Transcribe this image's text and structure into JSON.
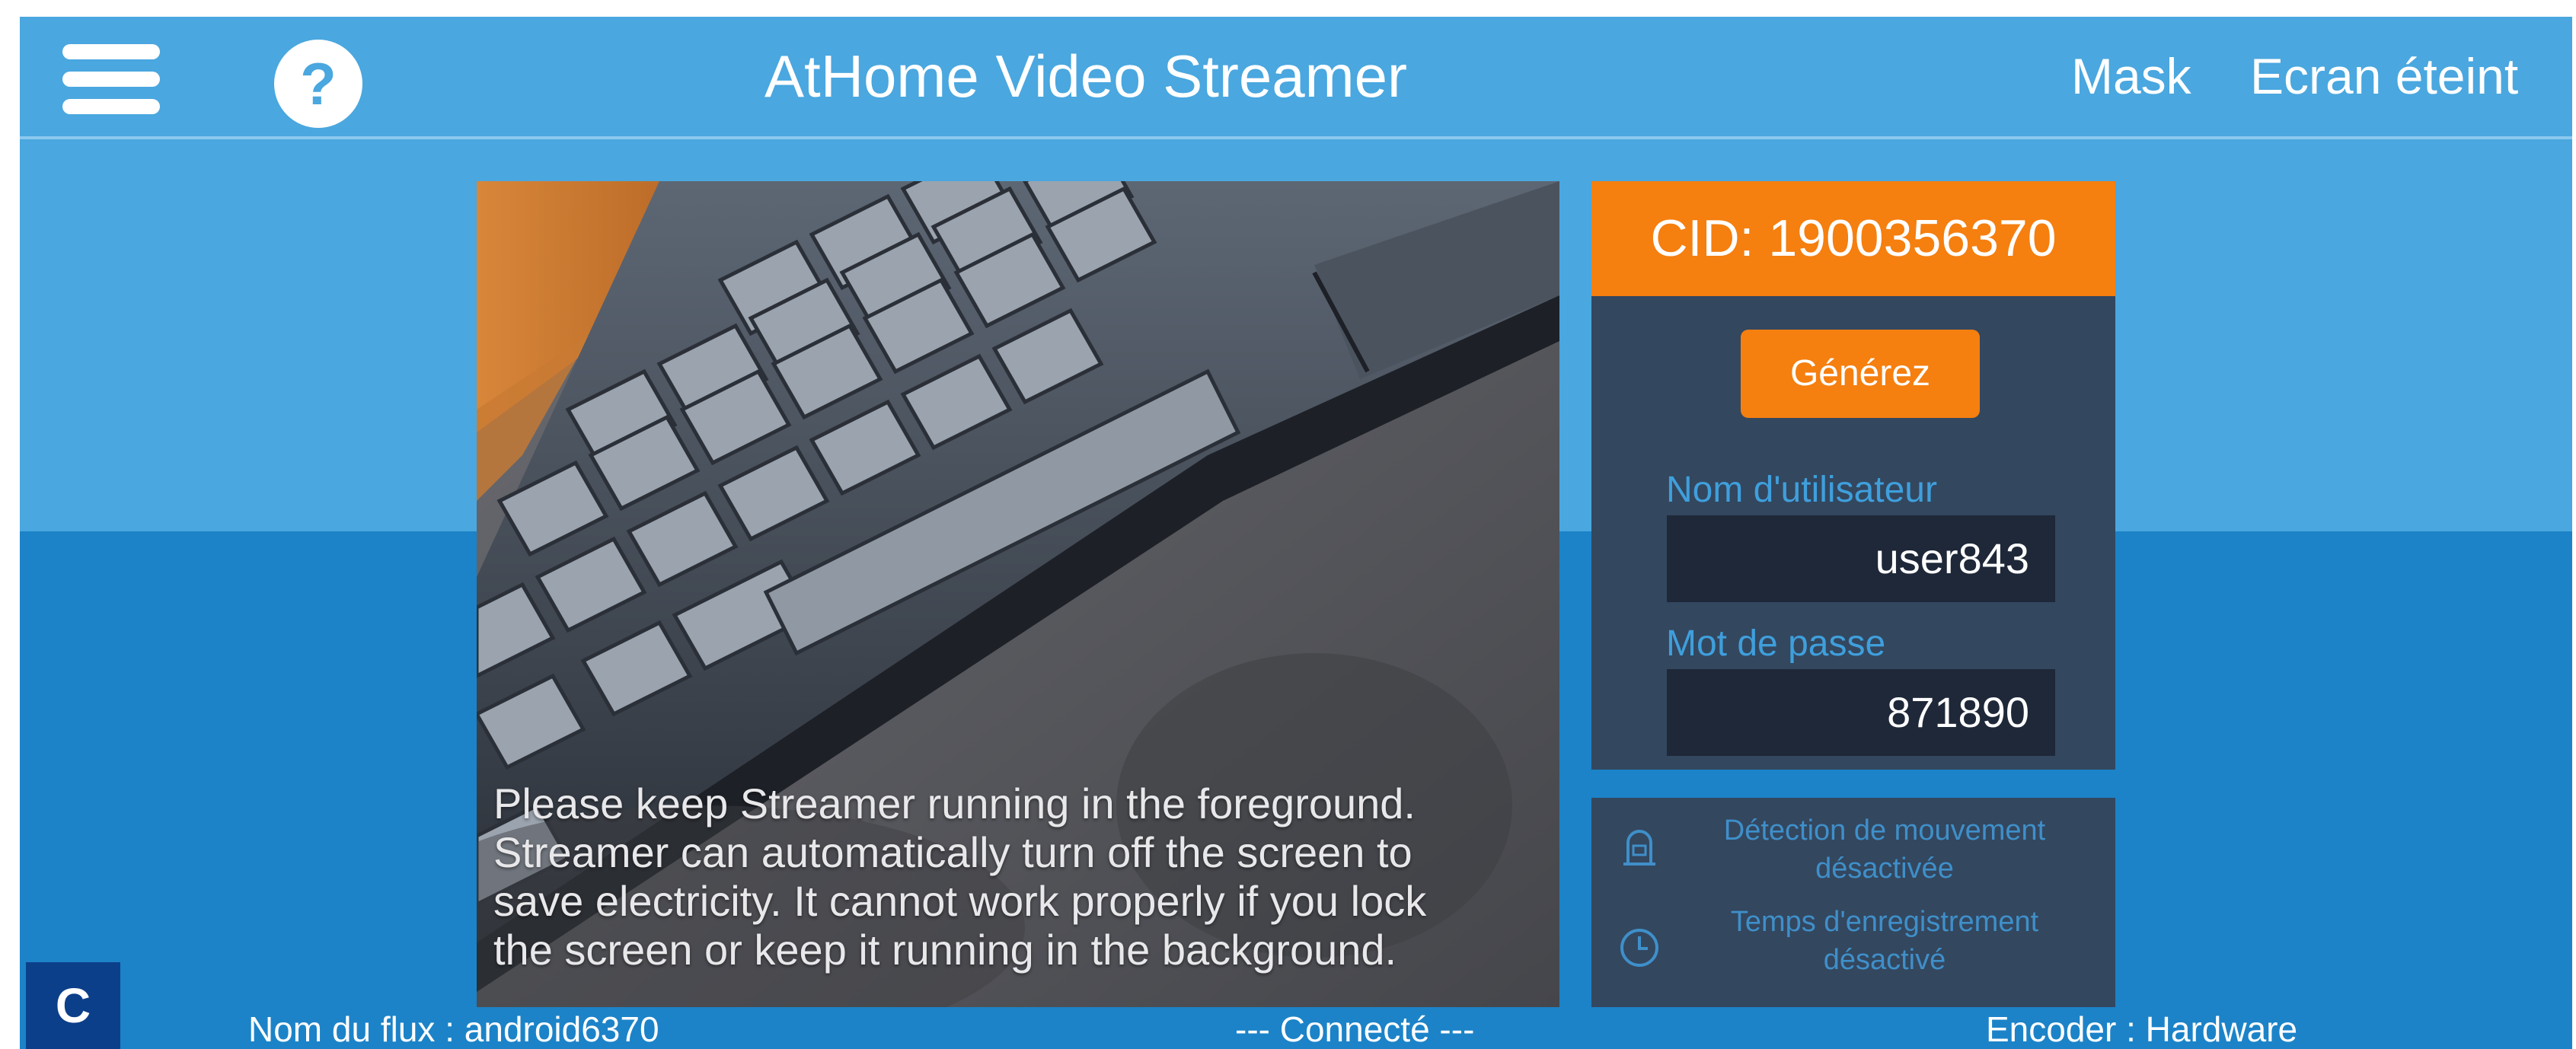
{
  "header": {
    "title": "AtHome Video Streamer",
    "menu_icon": "hamburger-menu-icon",
    "help_icon": "question-circle-icon",
    "actions": [
      "Mask",
      "Ecran éteint"
    ]
  },
  "preview": {
    "message_lines": [
      "Please keep Streamer running in the foreground.",
      "Streamer can automatically turn off the screen to",
      "save electricity. It cannot work properly if you lock",
      "the screen or keep it running in the background."
    ]
  },
  "connection_panel": {
    "cid": "CID: 1900356370",
    "generate_label": "Générez",
    "username_label": "Nom d'utilisateur",
    "username_value": "user843",
    "password_label": "Mot de passe",
    "password_value": "871890"
  },
  "status_panel": {
    "motion_detection": {
      "icon": "motion-sensor-icon",
      "line1": "Détection de mouvement",
      "line2": "désactivée"
    },
    "recording_time": {
      "icon": "clock-icon",
      "line1": "Temps d'enregistrement",
      "line2": "désactivé"
    }
  },
  "footer": {
    "badge": "C",
    "stream_name": "Nom du flux  : android6370",
    "connection_status": "--- Connecté ---",
    "encoder": "Encoder : Hardware"
  },
  "colors": {
    "header_blue": "#4aa7df",
    "band_blue": "#1c83c8",
    "accent_orange": "#f57f0f",
    "panel_navy": "#33475f",
    "field_dark": "#1e2838",
    "label_blue": "#3f9fdc",
    "badge_blue": "#0c3f8a"
  }
}
